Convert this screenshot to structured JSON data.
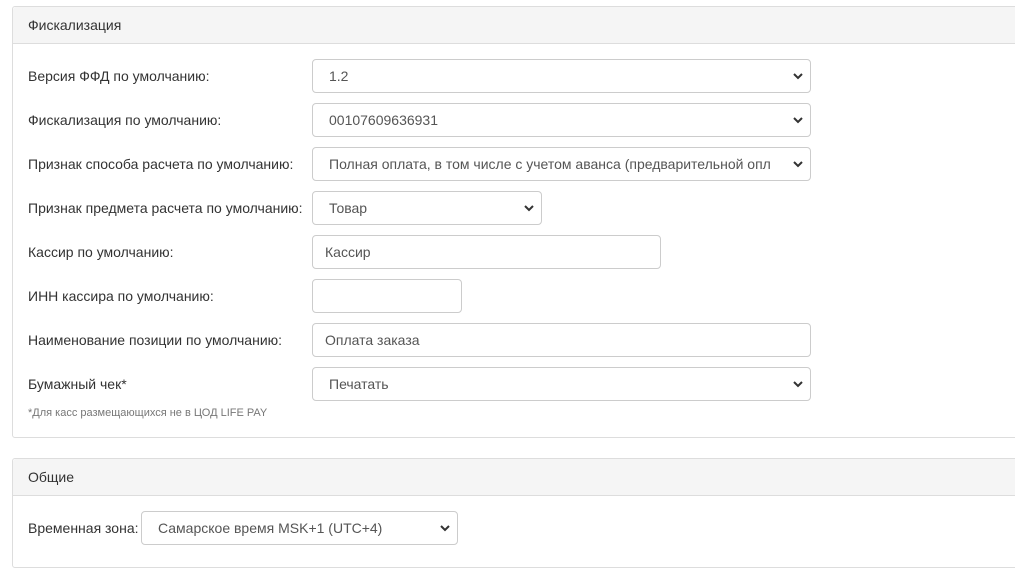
{
  "fiscal_panel": {
    "title": "Фискализация",
    "ffd_version": {
      "label": "Версия ФФД по умолчанию:",
      "value": "1.2"
    },
    "fiscalization": {
      "label": "Фискализация по умолчанию:",
      "value": "00107609636931"
    },
    "payment_method": {
      "label": "Признак способа расчета по умолчанию:",
      "value": "Полная оплата, в том числе с учетом аванса (предварительной оплат"
    },
    "payment_subject": {
      "label": "Признак предмета расчета по умолчанию:",
      "value": "Товар"
    },
    "cashier": {
      "label": "Кассир по умолчанию:",
      "value": "Кассир"
    },
    "cashier_inn": {
      "label": "ИНН кассира по умолчанию:",
      "value": ""
    },
    "item_name": {
      "label": "Наименование позиции по умолчанию:",
      "value": "Оплата заказа"
    },
    "paper_receipt": {
      "label": "Бумажный чек*",
      "value": "Печатать"
    },
    "footnote": "*Для касс размещающихся не в ЦОД LIFE PAY"
  },
  "general_panel": {
    "title": "Общие",
    "timezone": {
      "label": "Временная зона:",
      "value": "Самарское время MSK+1 (UTC+4)"
    }
  },
  "icons": {
    "select_arrow": "chevron-down-icon"
  }
}
